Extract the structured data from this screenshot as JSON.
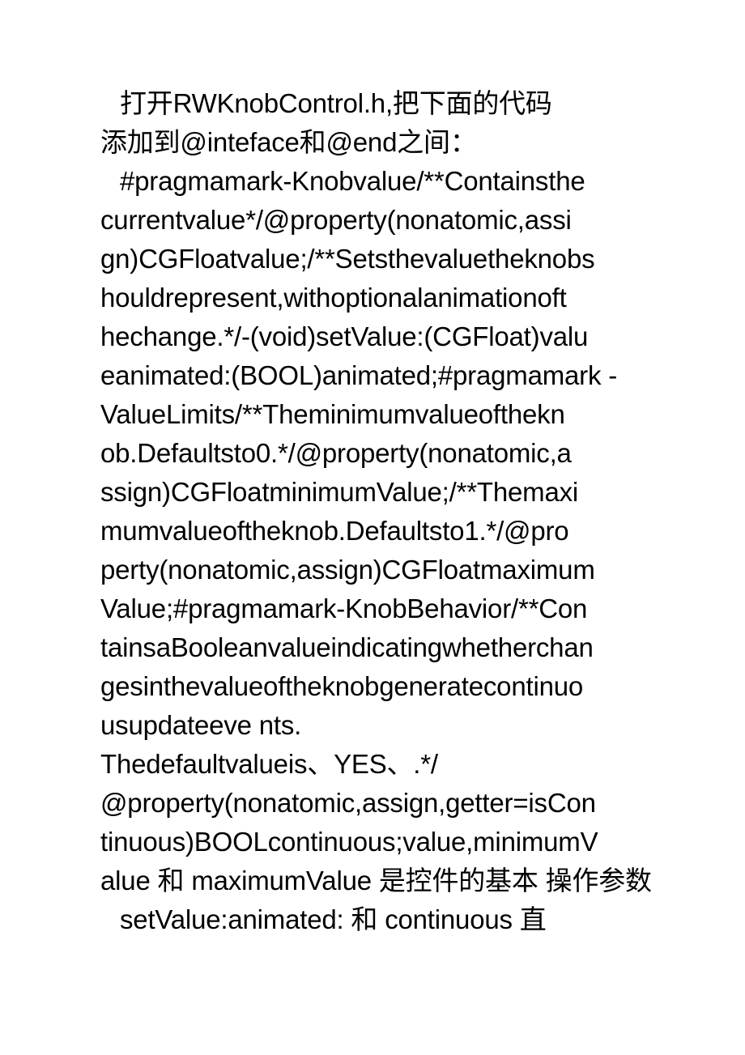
{
  "document": {
    "background_color": "#ffffff",
    "text_color": "#000000",
    "lines": [
      {
        "text": "打开RWKnobControl.h,把下面的代码",
        "indent": true
      },
      {
        "text": "添加到@inteface和@end之间：",
        "indent": false
      },
      {
        "text": "#pragmamark-Knobvalue/**Containsthe",
        "indent": true
      },
      {
        "text": "currentvalue*/@property(nonatomic,assi",
        "indent": false
      },
      {
        "text": "gn)CGFloatvalue;/**Setsthevaluetheknobs",
        "indent": false
      },
      {
        "text": "houldrepresent,withoptionalanimationoft",
        "indent": false
      },
      {
        "text": "hechange.*/-(void)setValue:(CGFloat)valu",
        "indent": false
      },
      {
        "text": "eanimated:(BOOL)animated;#pragmamark -",
        "indent": false
      },
      {
        "text": "ValueLimits/**Theminimumvalueofthekn",
        "indent": false
      },
      {
        "text": "ob.Defaultsto0.*/@property(nonatomic,a",
        "indent": false
      },
      {
        "text": "ssign)CGFloatminimumValue;/**Themaxi",
        "indent": false
      },
      {
        "text": "mumvalueoftheknob.Defaultsto1.*/@pro",
        "indent": false
      },
      {
        "text": "perty(nonatomic,assign)CGFloatmaximum",
        "indent": false
      },
      {
        "text": "Value;#pragmamark-KnobBehavior/**Con",
        "indent": false
      },
      {
        "text": "tainsaBooleanvalueindicatingwhetherchan",
        "indent": false
      },
      {
        "text": "gesinthevalueoftheknobgeneratecontinuo",
        "indent": false
      },
      {
        "text": "usupdateeve nts.",
        "indent": false
      },
      {
        "text": "Thedefaultvalueis、YES、.*/",
        "indent": false
      },
      {
        "text": "@property(nonatomic,assign,getter=isCon",
        "indent": false
      },
      {
        "text": "tinuous)BOOLcontinuous;value,minimumV",
        "indent": false
      },
      {
        "text": "alue 和 maximumValue 是控件的基本 操作参数",
        "indent": false
      },
      {
        "text": "setValue:animated: 和 continuous 直",
        "indent": true
      }
    ]
  }
}
